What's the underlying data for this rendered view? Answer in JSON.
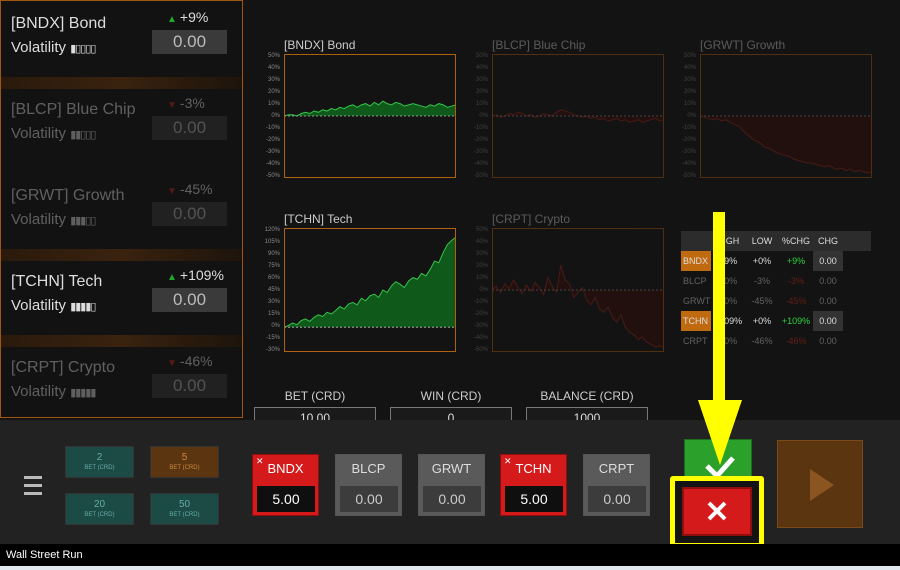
{
  "stocks": [
    {
      "name": "[BNDX] Bond",
      "volatility_label": "Volatility",
      "volatility_bars": "▮▯▯▯▯",
      "change": "+9%",
      "direction": "up",
      "value": "0.00"
    },
    {
      "name": "[BLCP] Blue Chip",
      "volatility_label": "Volatility",
      "volatility_bars": "▮▮▯▯▯",
      "change": "-3%",
      "direction": "down",
      "value": "0.00"
    },
    {
      "name": "[GRWT] Growth",
      "volatility_label": "Volatility",
      "volatility_bars": "▮▮▮▯▯",
      "change": "-45%",
      "direction": "down",
      "value": "0.00"
    },
    {
      "name": "[TCHN] Tech",
      "volatility_label": "Volatility",
      "volatility_bars": "▮▮▮▮▯",
      "change": "+109%",
      "direction": "up",
      "value": "0.00"
    },
    {
      "name": "[CRPT] Crypto",
      "volatility_label": "Volatility",
      "volatility_bars": "▮▮▮▮▮",
      "change": "-46%",
      "direction": "down",
      "value": "0.00"
    }
  ],
  "charts": [
    {
      "title": "[BNDX] Bond",
      "yticks": [
        "50%",
        "40%",
        "30%",
        "20%",
        "10%",
        "0%",
        "-10%",
        "-20%",
        "-30%",
        "-40%",
        "-50%"
      ],
      "ylim": [
        -50,
        50
      ],
      "trend": "up",
      "values": [
        0,
        1,
        1,
        0,
        2,
        3,
        2,
        4,
        3,
        5,
        4,
        6,
        5,
        7,
        6,
        8,
        9,
        7,
        9,
        10,
        8,
        11,
        9,
        12,
        10,
        9,
        11,
        10,
        8,
        9,
        10,
        9,
        8,
        7,
        9,
        8,
        10,
        9,
        7,
        8,
        9
      ]
    },
    {
      "title": "[BLCP] Blue Chip",
      "yticks": [
        "50%",
        "40%",
        "30%",
        "20%",
        "10%",
        "0%",
        "-10%",
        "-20%",
        "-30%",
        "-40%",
        "-50%"
      ],
      "ylim": [
        -50,
        50
      ],
      "trend": "down",
      "values": [
        0,
        1,
        -1,
        0,
        2,
        1,
        3,
        2,
        0,
        1,
        -1,
        0,
        2,
        1,
        0,
        3,
        5,
        4,
        3,
        1,
        0,
        -1,
        0,
        -2,
        -1,
        -3,
        -2,
        -4,
        -3,
        -2,
        -4,
        -3,
        -5,
        -4,
        -3,
        -5,
        -4,
        -3,
        -2,
        -4,
        -3
      ]
    },
    {
      "title": "[GRWT] Growth",
      "yticks": [
        "50%",
        "40%",
        "30%",
        "20%",
        "10%",
        "0%",
        "-10%",
        "-20%",
        "-30%",
        "-40%",
        "-50%"
      ],
      "ylim": [
        -50,
        50
      ],
      "trend": "down",
      "values": [
        0,
        -1,
        -2,
        -3,
        -2,
        -4,
        -3,
        -5,
        -7,
        -8,
        -12,
        -15,
        -18,
        -20,
        -22,
        -25,
        -26,
        -28,
        -30,
        -31,
        -32,
        -33,
        -35,
        -36,
        -37,
        -38,
        -38,
        -39,
        -40,
        -41,
        -40,
        -42,
        -43,
        -42,
        -44,
        -43,
        -45,
        -44,
        -45,
        -46,
        -45
      ]
    },
    {
      "title": "[TCHN] Tech",
      "yticks": [
        "120%",
        "105%",
        "90%",
        "75%",
        "60%",
        "45%",
        "30%",
        "15%",
        "0%",
        "-15%",
        "-30%"
      ],
      "ylim": [
        -30,
        120
      ],
      "trend": "up",
      "values": [
        0,
        2,
        5,
        3,
        8,
        10,
        7,
        12,
        15,
        13,
        18,
        16,
        20,
        25,
        22,
        28,
        30,
        27,
        35,
        32,
        38,
        40,
        36,
        45,
        42,
        50,
        55,
        52,
        48,
        56,
        60,
        58,
        65,
        62,
        70,
        80,
        78,
        90,
        100,
        105,
        109
      ]
    },
    {
      "title": "[CRPT] Crypto",
      "yticks": [
        "50%",
        "40%",
        "30%",
        "20%",
        "10%",
        "0%",
        "-10%",
        "-20%",
        "-30%",
        "-40%",
        "-50%"
      ],
      "ylim": [
        -50,
        50
      ],
      "trend": "down",
      "values": [
        0,
        3,
        -2,
        5,
        1,
        8,
        2,
        -3,
        4,
        -1,
        6,
        2,
        -4,
        10,
        3,
        -2,
        20,
        8,
        5,
        -6,
        -2,
        2,
        -8,
        -12,
        -6,
        -15,
        -18,
        -14,
        -22,
        -26,
        -20,
        -30,
        -34,
        -36,
        -40,
        -38,
        -42,
        -44,
        -46,
        -45,
        -46
      ]
    }
  ],
  "table": {
    "headers": [
      "",
      "HIGH",
      "LOW",
      "%CHG",
      "CHG"
    ],
    "rows": [
      {
        "sym": "BNDX",
        "high": "+9%",
        "low": "+0%",
        "pchg": "+9%",
        "chg": "0.00",
        "active": true,
        "dir": "up"
      },
      {
        "sym": "BLCP",
        "high": "+0%",
        "low": "-3%",
        "pchg": "-3%",
        "chg": "0.00",
        "active": false,
        "dir": "down"
      },
      {
        "sym": "GRWT",
        "high": "+0%",
        "low": "-45%",
        "pchg": "-45%",
        "chg": "0.00",
        "active": false,
        "dir": "down"
      },
      {
        "sym": "TCHN",
        "high": "+109%",
        "low": "+0%",
        "pchg": "+109%",
        "chg": "0.00",
        "active": true,
        "dir": "up"
      },
      {
        "sym": "CRPT",
        "high": "+0%",
        "low": "-46%",
        "pchg": "-46%",
        "chg": "0.00",
        "active": false,
        "dir": "down"
      }
    ]
  },
  "bet": {
    "label": "BET (CRD)",
    "value": "10.00"
  },
  "win": {
    "label": "WIN (CRD)",
    "value": "0"
  },
  "balance": {
    "label": "BALANCE (CRD)",
    "value": "1000"
  },
  "chips": [
    {
      "amount": "2",
      "unit": "BET (CRD)"
    },
    {
      "amount": "5",
      "unit": "BET (CRD)"
    },
    {
      "amount": "20",
      "unit": "BET (CRD)"
    },
    {
      "amount": "50",
      "unit": "BET (CRD)"
    }
  ],
  "stock_buttons": [
    {
      "sym": "BNDX",
      "value": "5.00",
      "selected": true
    },
    {
      "sym": "BLCP",
      "value": "0.00",
      "selected": false
    },
    {
      "sym": "GRWT",
      "value": "0.00",
      "selected": false
    },
    {
      "sym": "TCHN",
      "value": "5.00",
      "selected": true
    },
    {
      "sym": "CRPT",
      "value": "0.00",
      "selected": false
    }
  ],
  "status_bar": {
    "title": "Wall Street Run"
  },
  "colors": {
    "accent_orange": "#b0600f",
    "up_green": "#1faa2e",
    "down_red": "#c0281c",
    "highlight_yellow": "#ffff00"
  }
}
